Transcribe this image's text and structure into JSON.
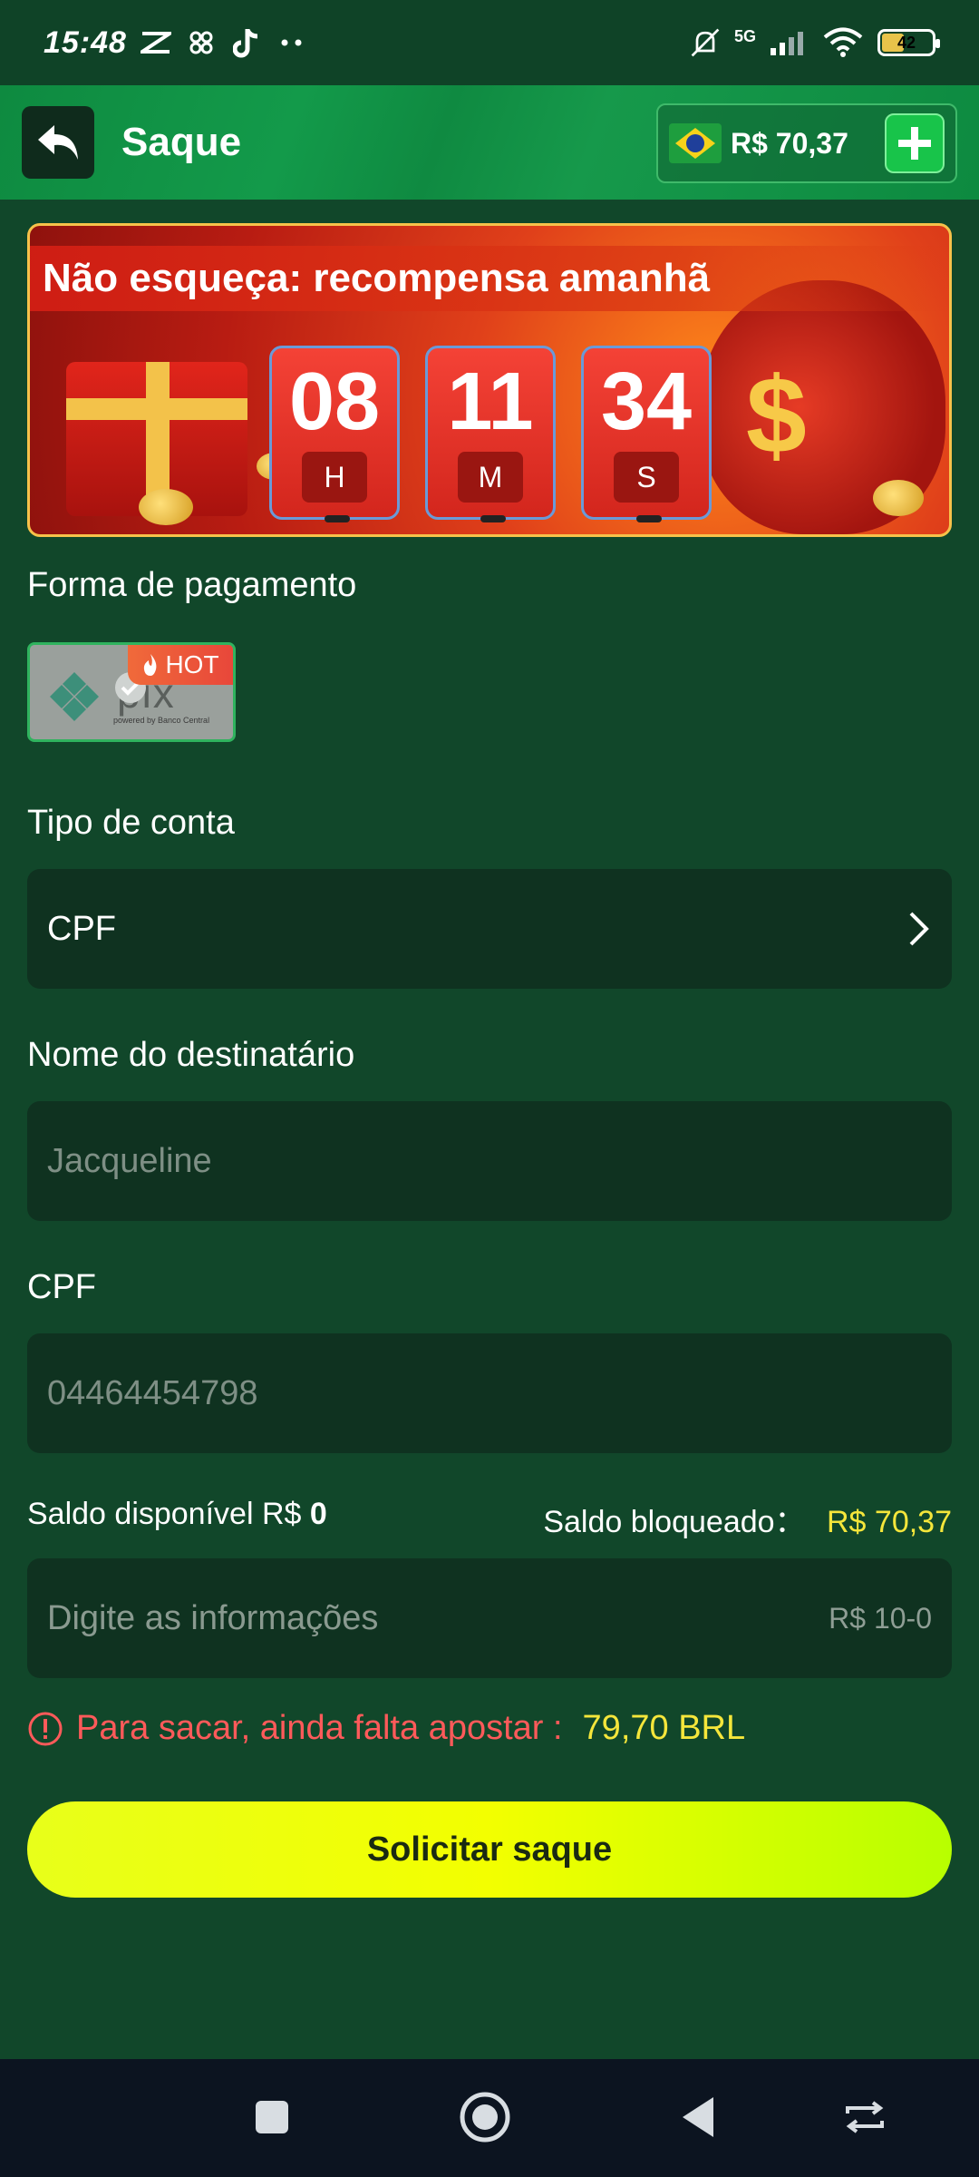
{
  "status_bar": {
    "time": "15:48",
    "network": "5G",
    "battery": "42",
    "battery_level": 0.42
  },
  "header": {
    "title": "Saque",
    "balance": "R$ 70,37"
  },
  "banner": {
    "title": "Não esqueça: recompensa amanhã",
    "timer": [
      {
        "value": "08",
        "unit": "H"
      },
      {
        "value": "11",
        "unit": "M"
      },
      {
        "value": "34",
        "unit": "S"
      }
    ]
  },
  "payment": {
    "label": "Forma de pagamento",
    "method_text": "pix",
    "method_sub": "powered by Banco Central",
    "hot_label": "HOT"
  },
  "account_type": {
    "label": "Tipo de conta",
    "value": "CPF"
  },
  "recipient": {
    "label": "Nome do destinatário",
    "placeholder": "Jacqueline"
  },
  "cpf": {
    "label": "CPF",
    "placeholder": "04464454798"
  },
  "saldo": {
    "available_label": "Saldo disponível R$",
    "available_value": "0",
    "blocked_label": "Saldo bloqueado：",
    "blocked_value": "R$ 70,37"
  },
  "amount": {
    "placeholder": "Digite as informações",
    "range": "R$ 10-0"
  },
  "warning": {
    "text": "Para sacar, ainda falta apostar :",
    "amount": "79,70 BRL"
  },
  "submit": {
    "label": "Solicitar saque"
  },
  "colors": {
    "background": "#11472a",
    "header": "#0e8a40",
    "accent_yellow": "#f5e63b",
    "warning_red": "#ff5a5a",
    "button": "#f3ff00"
  }
}
